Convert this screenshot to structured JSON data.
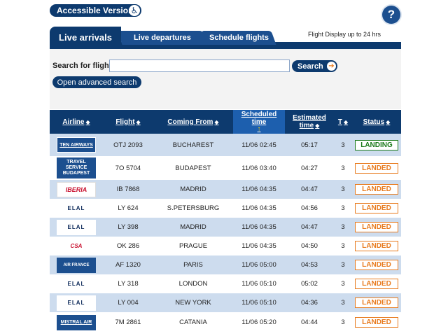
{
  "accessible_label": "Accessible Version",
  "help_label": "?",
  "tabs": {
    "arrivals": "Live arrivals",
    "departures": "Live departures",
    "schedule": "Schedule flights"
  },
  "display_note": "Flight Display up to 24 hrs",
  "search": {
    "label": "Search for flight",
    "value": "",
    "button": "Search",
    "advanced": "Open advanced search"
  },
  "table": {
    "headers": {
      "airline": "Airline",
      "flight": "Flight",
      "coming_from": "Coming From",
      "scheduled": "Scheduled time",
      "estimated_1": "Estimated",
      "estimated_2": "time",
      "terminal": "T",
      "status": "Status"
    },
    "rows": [
      {
        "logo": "TEN AIRWAYS",
        "flight": "OTJ 2093",
        "from": "BUCHAREST",
        "scheduled": "11/06 02:45",
        "estimated": "05:17",
        "terminal": "3",
        "status": "LANDING"
      },
      {
        "logo": "TRAVEL SERVICE BUDAPEST",
        "flight": "7O 5704",
        "from": "BUDAPEST",
        "scheduled": "11/06 03:40",
        "estimated": "04:27",
        "terminal": "3",
        "status": "LANDED"
      },
      {
        "logo": "IBERIA",
        "flight": "IB 7868",
        "from": "MADRID",
        "scheduled": "11/06 04:35",
        "estimated": "04:47",
        "terminal": "3",
        "status": "LANDED"
      },
      {
        "logo": "ELAL",
        "flight": "LY 624",
        "from": "S.PETERSBURG",
        "scheduled": "11/06 04:35",
        "estimated": "04:56",
        "terminal": "3",
        "status": "LANDED"
      },
      {
        "logo": "ELAL",
        "flight": "LY 398",
        "from": "MADRID",
        "scheduled": "11/06 04:35",
        "estimated": "04:47",
        "terminal": "3",
        "status": "LANDED"
      },
      {
        "logo": "CSA",
        "flight": "OK 286",
        "from": "PRAGUE",
        "scheduled": "11/06 04:35",
        "estimated": "04:50",
        "terminal": "3",
        "status": "LANDED"
      },
      {
        "logo": "AIR FRANCE",
        "flight": "AF 1320",
        "from": "PARIS",
        "scheduled": "11/06 05:00",
        "estimated": "04:53",
        "terminal": "3",
        "status": "LANDED"
      },
      {
        "logo": "ELAL",
        "flight": "LY 318",
        "from": "LONDON",
        "scheduled": "11/06 05:10",
        "estimated": "05:02",
        "terminal": "3",
        "status": "LANDED"
      },
      {
        "logo": "ELAL",
        "flight": "LY 004",
        "from": "NEW YORK",
        "scheduled": "11/06 05:10",
        "estimated": "04:36",
        "terminal": "3",
        "status": "LANDED"
      },
      {
        "logo": "MISTRAL AIR",
        "flight": "7M 2861",
        "from": "CATANIA",
        "scheduled": "11/06 05:20",
        "estimated": "04:44",
        "terminal": "3",
        "status": "LANDED"
      }
    ]
  },
  "colors": {
    "navy": "#0d3a6e",
    "row_alt": "#cddcee",
    "landed": "#e87b1e",
    "landing": "#1b7a1b"
  }
}
